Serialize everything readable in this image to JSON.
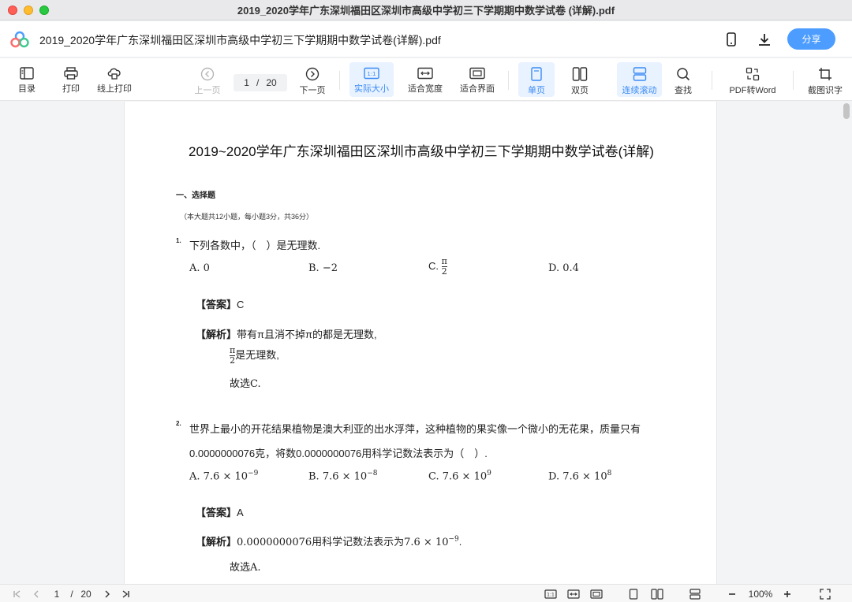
{
  "window": {
    "title": "2019_2020学年广东深圳福田区深圳市高级中学初三下学期期中数学试卷 (详解).pdf"
  },
  "header": {
    "file_title": "2019_2020学年广东深圳福田区深圳市高级中学初三下学期期中数学试卷(详解).pdf",
    "share_label": "分享",
    "icons": [
      "mobile-icon",
      "download-icon"
    ]
  },
  "toolbar": {
    "toc": "目录",
    "print": "打印",
    "online_print": "线上打印",
    "prev_page": "上一页",
    "page_current": "1",
    "page_sep": "/",
    "page_total": "20",
    "next_page": "下一页",
    "actual_size": "实际大小",
    "fit_width": "适合宽度",
    "fit_page": "适合界面",
    "single_page": "单页",
    "double_page": "双页",
    "continuous": "连续滚动",
    "search": "查找",
    "pdf_to_word": "PDF转Word",
    "ocr": "截图识字",
    "accent": "#3a8bf5"
  },
  "document": {
    "title": "2019~2020学年广东深圳福田区深圳市高级中学初三下学期期中数学试卷(详解)",
    "section": "一、选择题",
    "section_note": "（本大题共12小题，每小题3分，共36分）",
    "q1": {
      "num": "1.",
      "text": "下列各数中，（　）是无理数.",
      "opt_a": "A. 0",
      "opt_b": "B. −2",
      "opt_c": "C.",
      "opt_c_num": "π",
      "opt_c_den": "2",
      "opt_d": "D. 0.4",
      "answer_label": "【答案】",
      "answer": "C",
      "analysis_label": "【解析】",
      "analysis_1": "带有π且消不掉π的都是无理数,",
      "analysis_2_num": "π",
      "analysis_2_den": "2",
      "analysis_2": "是无理数,",
      "analysis_3": "故选C."
    },
    "q2": {
      "num": "2.",
      "text_1": "世界上最小的开花结果植物是澳大利亚的出水浮萍，这种植物的果实像一个微小的无花果，质量只有",
      "text_2": "0.0000000076克，将数0.0000000076用科学记数法表示为（　）.",
      "opt_a": "A. 7.6 × 10",
      "opt_a_exp": "−9",
      "opt_b": "B. 7.6 × 10",
      "opt_b_exp": "−8",
      "opt_c": "C. 7.6 × 10",
      "opt_c_exp": "9",
      "opt_d": "D. 7.6 × 10",
      "opt_d_exp": "8",
      "answer_label": "【答案】",
      "answer": "A",
      "analysis_label": "【解析】",
      "analysis_1": "0.0000000076用科学记数法表示为7.6 × 10",
      "analysis_1_exp": "−9",
      "analysis_1_end": ".",
      "analysis_2": "故选A."
    }
  },
  "statusbar": {
    "page_current": "1",
    "page_sep": "/",
    "page_total": "20",
    "zoom": "100%"
  }
}
